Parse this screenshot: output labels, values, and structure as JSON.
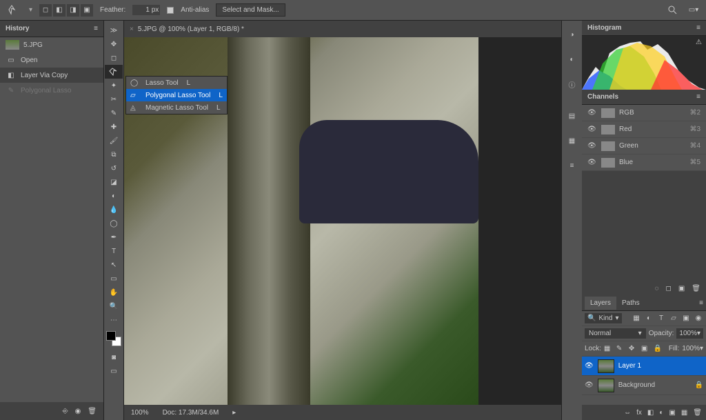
{
  "optionsBar": {
    "featherLabel": "Feather:",
    "featherValue": "1 px",
    "antiAliasLabel": "Anti-alias",
    "selectMaskLabel": "Select and Mask..."
  },
  "historyPanel": {
    "title": "History",
    "items": [
      {
        "label": "5.JPG",
        "type": "doc"
      },
      {
        "label": "Open",
        "type": "step"
      },
      {
        "label": "Layer Via Copy",
        "type": "step",
        "selected": true
      },
      {
        "label": "Polygonal Lasso",
        "type": "step",
        "dim": true
      }
    ]
  },
  "lassoFlyout": {
    "items": [
      {
        "label": "Lasso Tool",
        "shortcut": "L"
      },
      {
        "label": "Polygonal Lasso Tool",
        "shortcut": "L",
        "selected": true
      },
      {
        "label": "Magnetic Lasso Tool",
        "shortcut": "L"
      }
    ]
  },
  "docTab": {
    "title": "5.JPG @ 100% (Layer 1, RGB/8) *"
  },
  "statusBar": {
    "zoom": "100%",
    "docInfo": "Doc: 17.3M/34.6M"
  },
  "histogramPanel": {
    "title": "Histogram"
  },
  "channelsPanel": {
    "title": "Channels",
    "channels": [
      {
        "name": "RGB",
        "shortcut": "⌘2"
      },
      {
        "name": "Red",
        "shortcut": "⌘3"
      },
      {
        "name": "Green",
        "shortcut": "⌘4"
      },
      {
        "name": "Blue",
        "shortcut": "⌘5"
      }
    ]
  },
  "layersPanel": {
    "tabs": [
      "Layers",
      "Paths"
    ],
    "kind": "Kind",
    "blendMode": "Normal",
    "opacityLabel": "Opacity:",
    "opacityVal": "100%",
    "lockLabel": "Lock:",
    "fillLabel": "Fill:",
    "fillVal": "100%",
    "layers": [
      {
        "name": "Layer 1",
        "selected": true
      },
      {
        "name": "Background",
        "locked": true
      }
    ]
  }
}
